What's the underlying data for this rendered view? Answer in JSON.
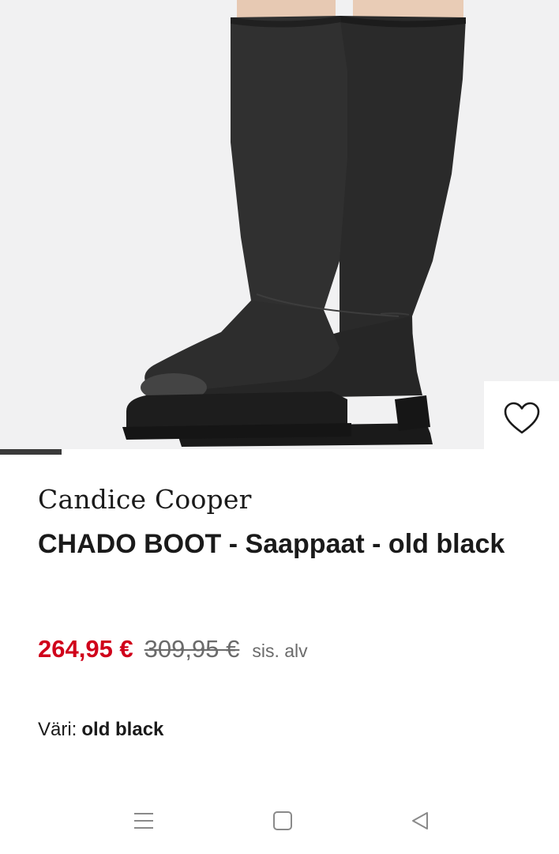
{
  "product": {
    "brand": "Candice Cooper",
    "name": "CHADO BOOT - Saappaat - old black",
    "image_icon": "knee-high-black-boots-image"
  },
  "price": {
    "current": "264,95 €",
    "original": "309,95 €",
    "tax_note": "sis. alv",
    "sale_color": "#d0021b"
  },
  "color": {
    "label": "Väri:",
    "value": "old black"
  },
  "carousel": {
    "active_index": 1
  },
  "wishlist": {
    "icon": "heart-outline-icon"
  },
  "system_nav": {
    "recents_icon": "menu-lines-icon",
    "home_icon": "square-icon",
    "back_icon": "triangle-back-icon"
  }
}
